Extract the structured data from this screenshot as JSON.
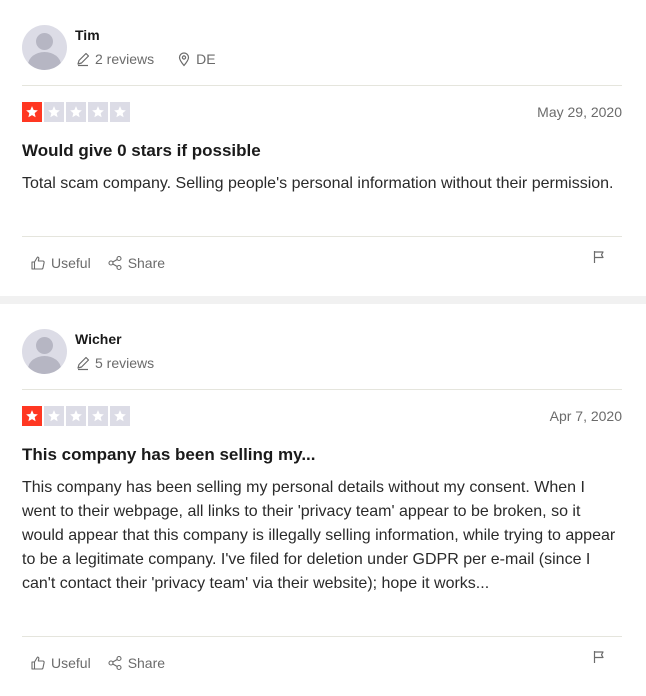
{
  "reviews": [
    {
      "reviewer": "Tim",
      "review_count": "2 reviews",
      "location": "DE",
      "rating": 1,
      "date": "May 29, 2020",
      "title": "Would give 0 stars if possible",
      "body": "Total scam company. Selling people's personal information without their permission.",
      "useful_label": "Useful",
      "share_label": "Share"
    },
    {
      "reviewer": "Wicher",
      "review_count": "5 reviews",
      "rating": 1,
      "date": "Apr 7, 2020",
      "title": "This company has been selling my...",
      "body": "This company has been selling my personal details without my consent. When I went to their webpage, all links to their 'privacy team' appear to be broken, so it would appear that this company is illegally selling information, while trying to appear to be a legitimate company. I've filed for deletion under GDPR per e-mail (since I can't contact their 'privacy team' via their website); hope it works...",
      "useful_label": "Useful",
      "share_label": "Share"
    }
  ],
  "colors": {
    "star_active": "#ff3722",
    "star_inactive": "#dcdce6",
    "muted_text": "#6b6b6b"
  },
  "icons": [
    "pencil-icon",
    "location-pin-icon",
    "star-icon",
    "thumbs-up-icon",
    "share-icon",
    "flag-icon"
  ]
}
